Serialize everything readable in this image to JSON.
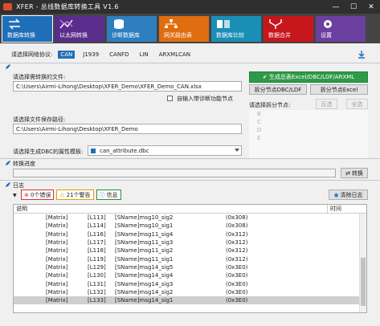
{
  "window": {
    "title": "XFER - 总线数据库转换工具 V1.6",
    "controls": [
      "—",
      "☐",
      "✕"
    ]
  },
  "tiles": [
    {
      "label": "数据库转换",
      "color": "#1f6fb8",
      "icon": "swap-icon",
      "active": true
    },
    {
      "label": "以太网转换",
      "color": "#5a2d8c",
      "icon": "chart-icon"
    },
    {
      "label": "诊断数据库",
      "color": "#2d7fc0",
      "icon": "database-icon"
    },
    {
      "label": "网关路由表",
      "color": "#e06d10",
      "icon": "network-icon"
    },
    {
      "label": "数据库比较",
      "color": "#1a8fb5",
      "icon": "compare-icon"
    },
    {
      "label": "数据合并",
      "color": "#c8161d",
      "icon": "merge-icon"
    },
    {
      "label": "设置",
      "color": "#6b3fa0",
      "icon": "gear-icon"
    }
  ],
  "protocol": {
    "label": "请选择网络协议:",
    "options": [
      "CAN",
      "J1939",
      "CANFD",
      "LIN",
      "ARXMLCAN"
    ],
    "selected": "CAN"
  },
  "source": {
    "label": "请选择需转换的文件:",
    "value": "C:\\Users\\Airmi-Lihong\\Desktop\\XFER_Demo\\XFER_Demo_CAN.xlsx",
    "checkbox_label": "自输入带诊断功能节点"
  },
  "actions": {
    "generate_label": "✔ 生成总表Excel/DBC/LDF/ARXML",
    "split_dbc_label": "拆分节点DBC/LDF",
    "split_excel_label": "拆分节点Excel",
    "split_nodes_label": "请选择拆分节点:",
    "invert_label": "反选",
    "all_label": "全选",
    "nodes": [
      "B",
      "C",
      "D",
      "E"
    ]
  },
  "save": {
    "label": "请选择文件保存路径:",
    "value": "C:\\Users\\Airmi-Lihong\\Desktop\\XFER_Demo"
  },
  "template": {
    "label": "请选择生成DBC的属性模板:",
    "value": "can_attribute.dbc"
  },
  "progress": {
    "label": "转换进度",
    "button_label": "转换",
    "value": 0
  },
  "log": {
    "label": "日志",
    "errors_label": "0个错误",
    "warnings_label": "21个警告",
    "info_label": "信息",
    "clear_label": "清除日志",
    "columns": [
      "说明",
      "时间"
    ],
    "rows": [
      [
        "[Matrix]",
        "[L113]",
        "[SName]msg10_sig2",
        "(0x308)"
      ],
      [
        "[Matrix]",
        "[L114]",
        "[SName]msg10_sig1",
        "(0x308)"
      ],
      [
        "[Matrix]",
        "[L116]",
        "[SName]msg11_sig4",
        "(0x312)"
      ],
      [
        "[Matrix]",
        "[L117]",
        "[SName]msg11_sig3",
        "(0x312)"
      ],
      [
        "[Matrix]",
        "[L118]",
        "[SName]msg11_sig2",
        "(0x312)"
      ],
      [
        "[Matrix]",
        "[L119]",
        "[SName]msg11_sig1",
        "(0x312)"
      ],
      [
        "[Matrix]",
        "[L129]",
        "[SName]msg14_sig5",
        "(0x3E0)"
      ],
      [
        "[Matrix]",
        "[L130]",
        "[SName]msg14_sig4",
        "(0x3E0)"
      ],
      [
        "[Matrix]",
        "[L131]",
        "[SName]msg14_sig3",
        "(0x3E0)"
      ],
      [
        "[Matrix]",
        "[L132]",
        "[SName]msg14_sig2",
        "(0x3E0)"
      ],
      [
        "[Matrix]",
        "[L133]",
        "[SName]msg14_sig1",
        "(0x3E0)"
      ]
    ]
  }
}
